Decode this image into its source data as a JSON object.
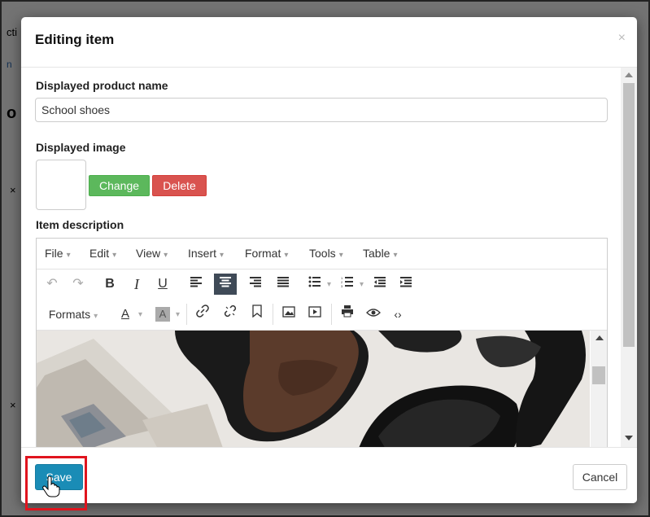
{
  "modal": {
    "title": "Editing item",
    "close_glyph": "×"
  },
  "product_name": {
    "label": "Displayed product name",
    "value": "School shoes"
  },
  "image": {
    "label": "Displayed image",
    "change_label": "Change",
    "delete_label": "Delete"
  },
  "description": {
    "label": "Item description"
  },
  "editor": {
    "menu": [
      "File",
      "Edit",
      "View",
      "Insert",
      "Format",
      "Tools",
      "Table"
    ],
    "formats_label": "Formats",
    "icons": [
      "undo-icon",
      "redo-icon",
      "bold-icon",
      "italic-icon",
      "underline-icon",
      "align-left-icon",
      "align-center-icon",
      "align-right-icon",
      "align-justify-icon",
      "bullet-list-icon",
      "numbered-list-icon",
      "outdent-icon",
      "indent-icon",
      "text-color-icon",
      "background-color-icon",
      "link-icon",
      "unlink-icon",
      "bookmark-icon",
      "image-icon",
      "media-icon",
      "print-icon",
      "preview-icon",
      "code-icon"
    ]
  },
  "footer": {
    "save_label": "Save",
    "cancel_label": "Cancel"
  },
  "colors": {
    "save": "#1a8cb6",
    "change": "#5cb85c",
    "delete": "#d9534f",
    "highlight": "#e0141e"
  }
}
